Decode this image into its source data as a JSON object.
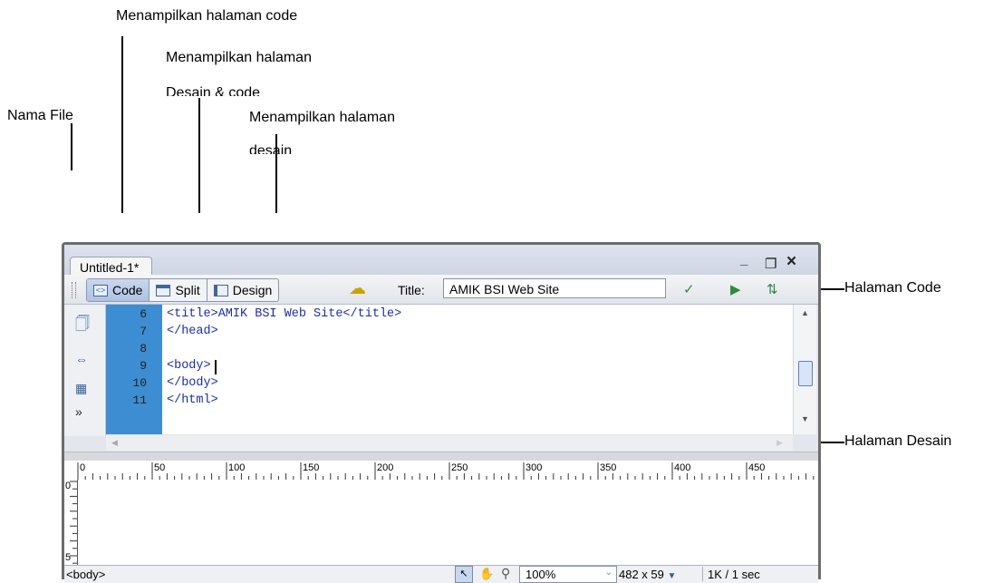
{
  "annotations": {
    "code_view": "Menampilkan halaman code",
    "split_view_line1": "Menampilkan halaman",
    "split_view_line2": "Desain & code",
    "file_name": "Nama File",
    "design_view_line1": "Menampilkan halaman",
    "design_view_line2": "desain",
    "code_pane": "Halaman Code",
    "design_pane": "Halaman Desain"
  },
  "window": {
    "tab_title": "Untitled-1*",
    "minimize": "_",
    "restore": "❐",
    "close": "×"
  },
  "toolbar": {
    "code_label": "Code",
    "split_label": "Split",
    "design_label": "Design",
    "title_label": "Title:",
    "title_value": "AMIK BSI Web Site"
  },
  "code": {
    "line_numbers": [
      "6",
      "7",
      "8",
      "9",
      "10",
      "11"
    ],
    "line6": "<title>AMIK BSI Web Site</title>",
    "line7": "</head>",
    "line9": "<body>",
    "line10": "</body>",
    "line11": "</html>"
  },
  "ruler": {
    "h_labels": [
      "0",
      "50",
      "100",
      "150",
      "200",
      "250",
      "300",
      "350",
      "400",
      "450"
    ],
    "v_labels": [
      "0",
      "5"
    ]
  },
  "status": {
    "tag_selector": "<body>",
    "zoom": "100%",
    "window_size": "482 x 59",
    "download": "1K / 1 sec"
  },
  "icons": [
    "code-view-icon",
    "split-view-icon",
    "design-view-icon",
    "live-data-icon",
    "validate-icon",
    "preview-icon",
    "file-transfer-icon"
  ]
}
